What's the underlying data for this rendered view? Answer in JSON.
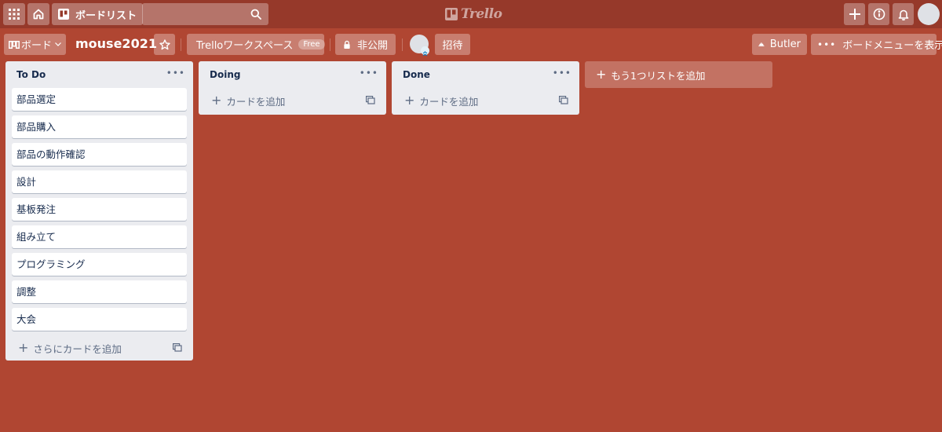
{
  "header": {
    "boards_label": "ボードリスト",
    "search_value": "",
    "logo_text": "Trello"
  },
  "board": {
    "switcher_label": "ボード",
    "title": "mouse2021",
    "workspace_label": "Trelloワークスペース",
    "workspace_badge": "Free",
    "visibility_label": "非公開",
    "invite_label": "招待",
    "butler_label": "Butler",
    "menu_label": "ボードメニューを表示",
    "background_color": "#b04632"
  },
  "lists": [
    {
      "title": "To Do",
      "cards": [
        "部品選定",
        "部品購入",
        "部品の動作確認",
        "設計",
        "基板発注",
        "組み立て",
        "プログラミング",
        "調整",
        "大会"
      ],
      "add_label": "さらにカードを追加"
    },
    {
      "title": "Doing",
      "cards": [],
      "add_label": "カードを追加"
    },
    {
      "title": "Done",
      "cards": [],
      "add_label": "カードを追加"
    }
  ],
  "add_list_label": "もう1つリストを追加"
}
